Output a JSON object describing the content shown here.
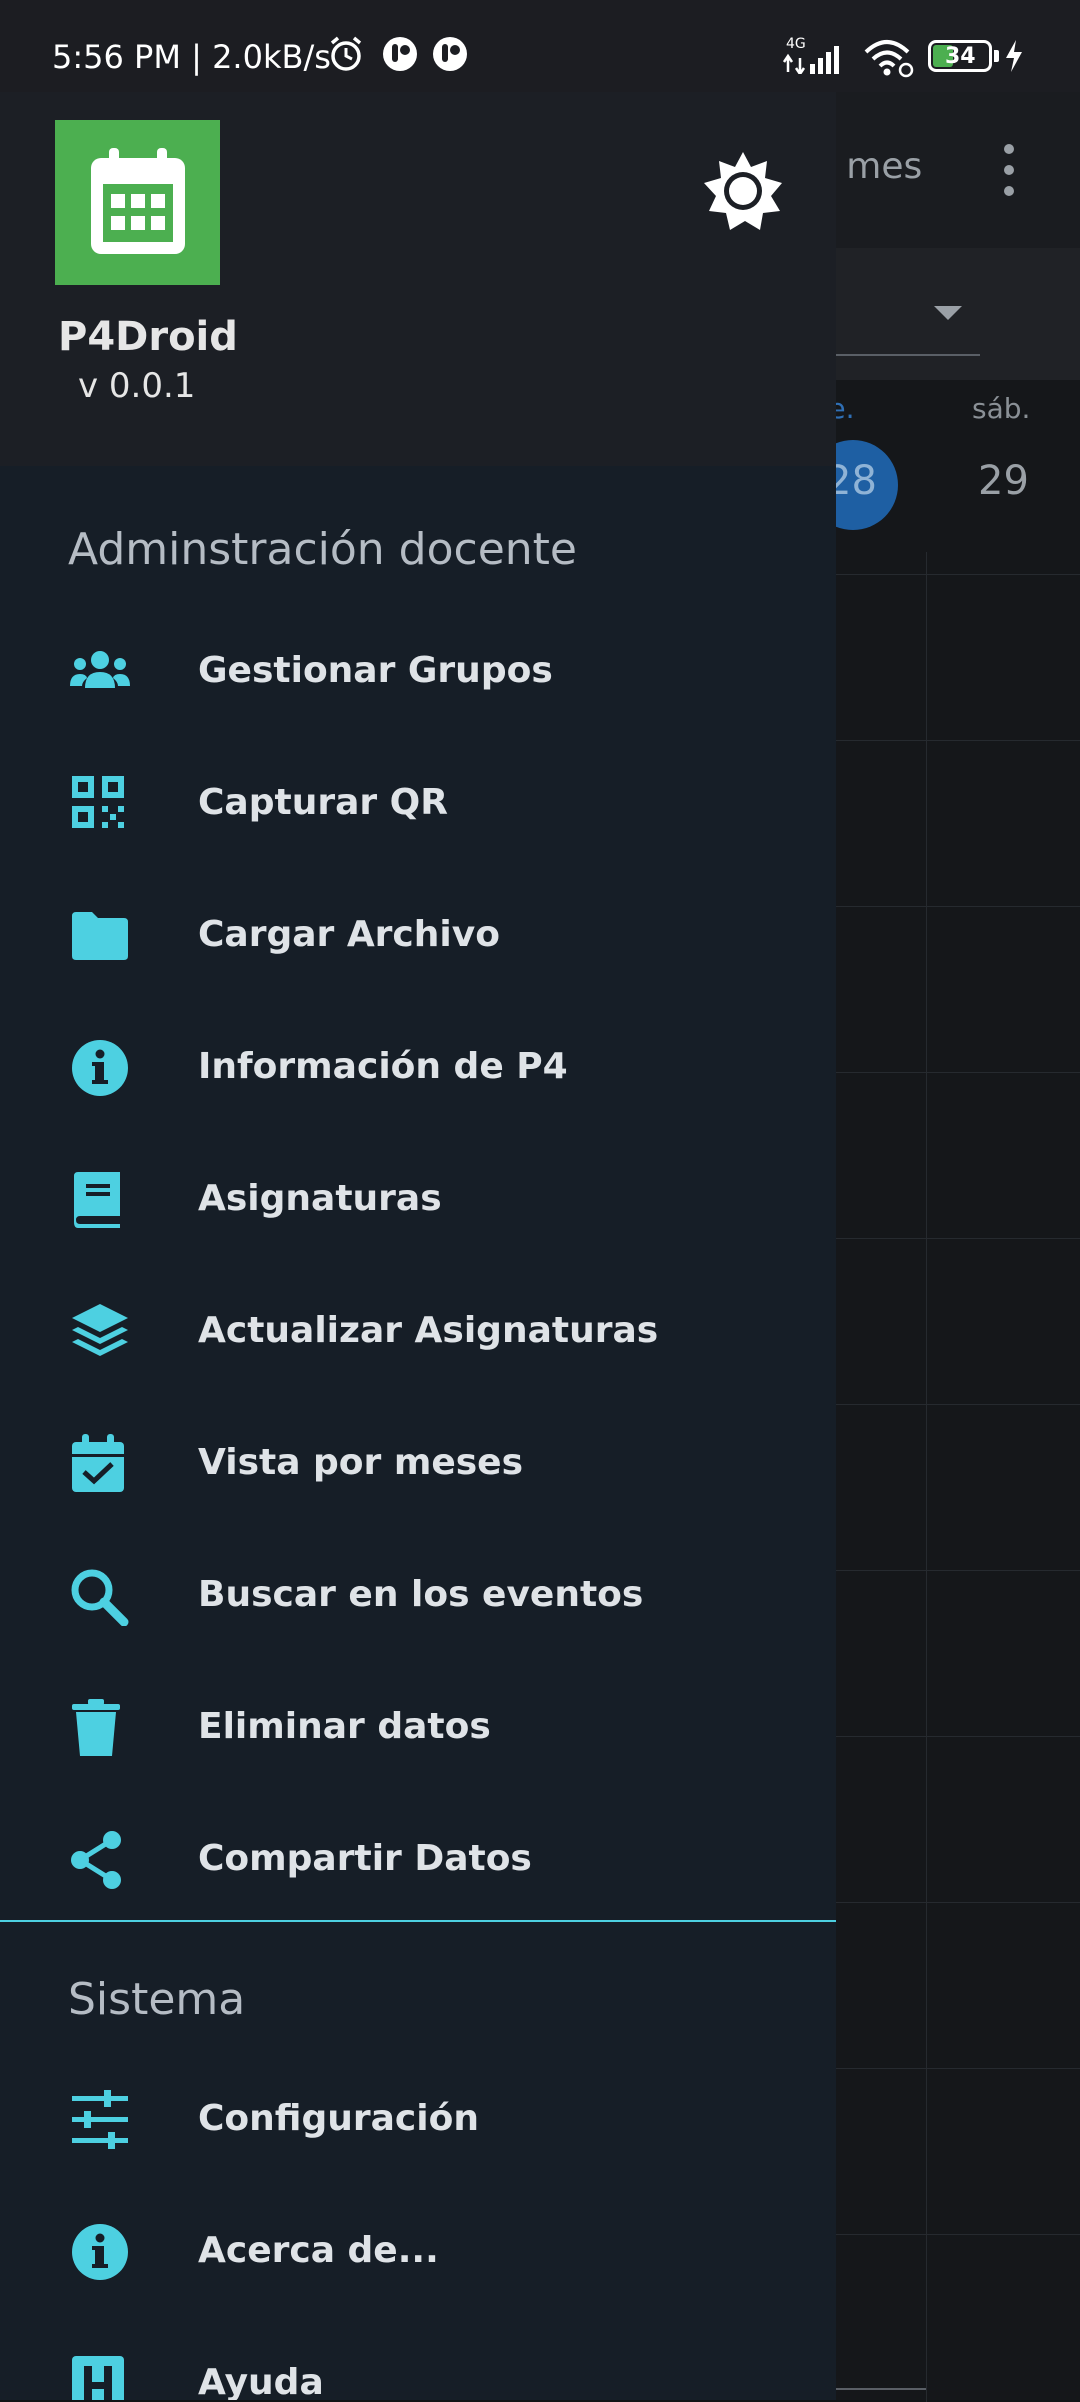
{
  "status_bar": {
    "time": "5:56 PM | 2.0kB/s",
    "network": "4G",
    "battery": "34"
  },
  "background": {
    "title_partial": "r mes",
    "days": [
      {
        "label": "vie.",
        "date": "28",
        "color": "#2f6fb5"
      },
      {
        "label": "sáb.",
        "date": "29",
        "color": "#8a9096"
      }
    ]
  },
  "drawer": {
    "app_name": "P4Droid",
    "app_version": "v 0.0.1",
    "logo_color": "#4caf50",
    "accent_color": "#4dd0e1",
    "sections": [
      {
        "title": "Adminstración docente",
        "items": [
          {
            "label": "Gestionar Grupos",
            "icon": "group-icon"
          },
          {
            "label": "Capturar QR",
            "icon": "qr-code-icon"
          },
          {
            "label": "Cargar Archivo",
            "icon": "folder-icon"
          },
          {
            "label": "Información de P4",
            "icon": "info-icon"
          },
          {
            "label": "Asignaturas",
            "icon": "book-icon"
          },
          {
            "label": "Actualizar Asignaturas",
            "icon": "layers-icon"
          },
          {
            "label": "Vista por meses",
            "icon": "calendar-check-icon"
          },
          {
            "label": "Buscar en los eventos",
            "icon": "search-icon"
          },
          {
            "label": "Eliminar datos",
            "icon": "trash-icon"
          },
          {
            "label": "Compartir Datos",
            "icon": "share-icon"
          }
        ]
      },
      {
        "title": "Sistema",
        "items": [
          {
            "label": "Configuración",
            "icon": "sliders-icon"
          },
          {
            "label": "Acerca de...",
            "icon": "info-icon"
          },
          {
            "label": "Ayuda",
            "icon": "help-h-icon"
          }
        ]
      }
    ]
  }
}
